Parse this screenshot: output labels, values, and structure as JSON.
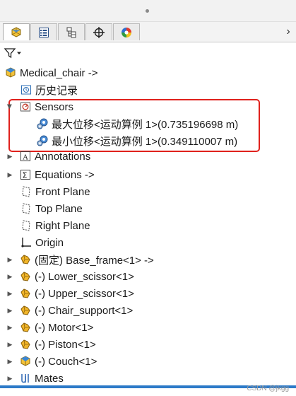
{
  "filter": {
    "icon": "funnel-icon"
  },
  "tabs": [
    {
      "name": "feature-manager",
      "icon": "part-cube-icon",
      "active": true
    },
    {
      "name": "property-manager",
      "icon": "property-list-icon",
      "active": false
    },
    {
      "name": "configuration-manager",
      "icon": "config-tree-icon",
      "active": false
    },
    {
      "name": "dimxpert-manager",
      "icon": "crosshair-icon",
      "active": false
    },
    {
      "name": "display-manager",
      "icon": "color-wheel-icon",
      "active": false
    }
  ],
  "tree": {
    "root": "Medical_chair ->",
    "history": "历史记录",
    "sensors": "Sensors",
    "sensor_max": "最大位移<运动算例 1>(0.735196698 m)",
    "sensor_min": "最小位移<运动算例 1>(0.349110007 m)",
    "annotations": "Annotations",
    "equations": "Equations ->",
    "front_plane": "Front Plane",
    "top_plane": "Top Plane",
    "right_plane": "Right Plane",
    "origin": "Origin",
    "base_frame": "(固定) Base_frame<1> ->",
    "lower_scissor": "(-) Lower_scissor<1>",
    "upper_scissor": "(-) Upper_scissor<1>",
    "chair_support": "(-) Chair_support<1>",
    "motor": "(-) Motor<1>",
    "piston": "(-) Piston<1>",
    "couch": "(-) Couch<1>",
    "mates": "Mates"
  },
  "watermark": "CSDN @jkgg",
  "colors": {
    "highlight": "#e0211d",
    "accent": "#2d7ac8"
  }
}
